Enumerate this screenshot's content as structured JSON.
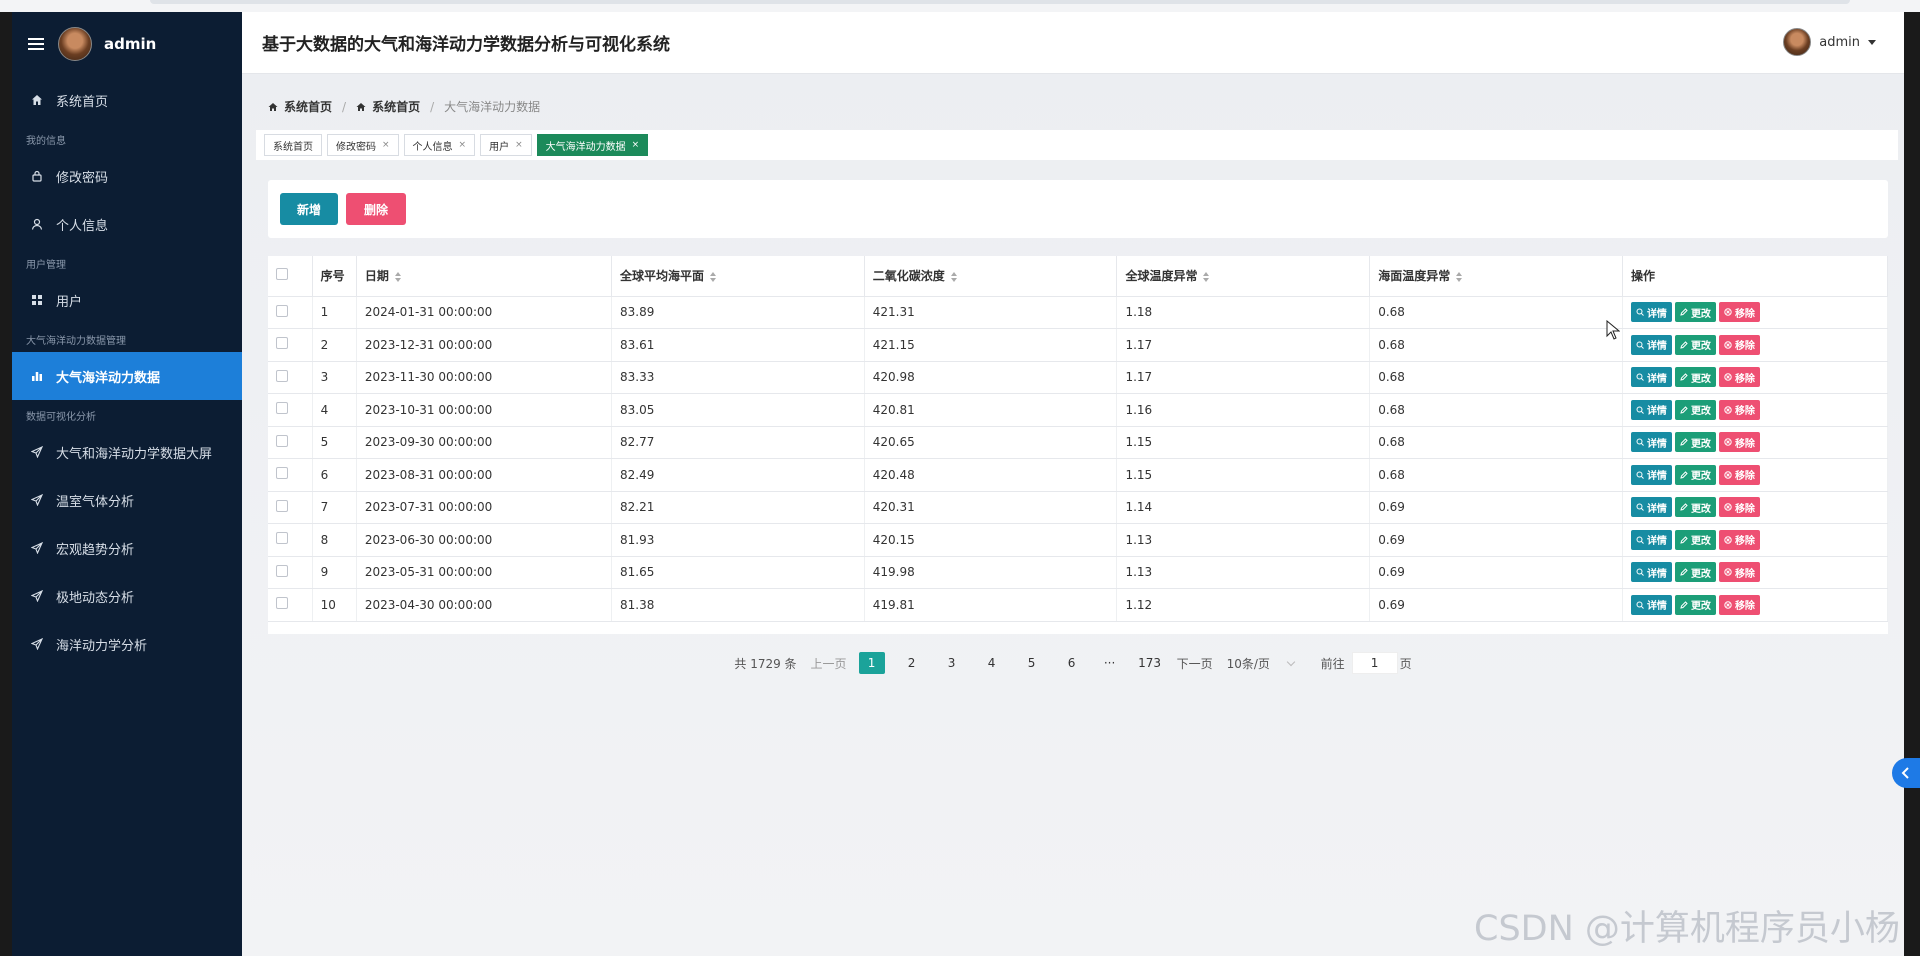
{
  "sidebar": {
    "username": "admin",
    "items": [
      {
        "type": "item",
        "label": "系统首页",
        "icon": "home-icon"
      },
      {
        "type": "group",
        "label": "我的信息"
      },
      {
        "type": "item",
        "label": "修改密码",
        "icon": "lock-icon"
      },
      {
        "type": "item",
        "label": "个人信息",
        "icon": "user-icon"
      },
      {
        "type": "group",
        "label": "用户管理"
      },
      {
        "type": "item",
        "label": "用户",
        "icon": "grid-icon"
      },
      {
        "type": "group",
        "label": "大气海洋动力数据管理"
      },
      {
        "type": "item",
        "label": "大气海洋动力数据",
        "icon": "bar-chart-icon",
        "active": true
      },
      {
        "type": "group",
        "label": "数据可视化分析"
      },
      {
        "type": "item",
        "label": "大气和海洋动力学数据大屏",
        "icon": "send-icon"
      },
      {
        "type": "item",
        "label": "温室气体分析",
        "icon": "send-icon"
      },
      {
        "type": "item",
        "label": "宏观趋势分析",
        "icon": "send-icon"
      },
      {
        "type": "item",
        "label": "极地动态分析",
        "icon": "send-icon"
      },
      {
        "type": "item",
        "label": "海洋动力学分析",
        "icon": "send-icon"
      }
    ]
  },
  "header": {
    "title": "基于大数据的大气和海洋动力学数据分析与可视化系统",
    "username": "admin"
  },
  "breadcrumb": [
    "系统首页",
    "系统首页",
    "大气海洋动力数据"
  ],
  "tags": [
    {
      "label": "系统首页",
      "closable": false
    },
    {
      "label": "修改密码",
      "closable": true
    },
    {
      "label": "个人信息",
      "closable": true
    },
    {
      "label": "用户",
      "closable": true
    },
    {
      "label": "大气海洋动力数据",
      "closable": true,
      "active": true
    }
  ],
  "tag_close": "×",
  "actions": {
    "add_label": "新增",
    "delete_label": "删除"
  },
  "table": {
    "columns": [
      "序号",
      "日期",
      "全球平均海平面",
      "二氧化碳浓度",
      "全球温度异常",
      "海面温度异常",
      "操作"
    ],
    "ops": {
      "view": "详情",
      "edit": "更改",
      "remove": "移除"
    },
    "rows": [
      [
        "1",
        "2024-01-31 00:00:00",
        "83.89",
        "421.31",
        "1.18",
        "0.68"
      ],
      [
        "2",
        "2023-12-31 00:00:00",
        "83.61",
        "421.15",
        "1.17",
        "0.68"
      ],
      [
        "3",
        "2023-11-30 00:00:00",
        "83.33",
        "420.98",
        "1.17",
        "0.68"
      ],
      [
        "4",
        "2023-10-31 00:00:00",
        "83.05",
        "420.81",
        "1.16",
        "0.68"
      ],
      [
        "5",
        "2023-09-30 00:00:00",
        "82.77",
        "420.65",
        "1.15",
        "0.68"
      ],
      [
        "6",
        "2023-08-31 00:00:00",
        "82.49",
        "420.48",
        "1.15",
        "0.68"
      ],
      [
        "7",
        "2023-07-31 00:00:00",
        "82.21",
        "420.31",
        "1.14",
        "0.69"
      ],
      [
        "8",
        "2023-06-30 00:00:00",
        "81.93",
        "420.15",
        "1.13",
        "0.69"
      ],
      [
        "9",
        "2023-05-31 00:00:00",
        "81.65",
        "419.98",
        "1.13",
        "0.69"
      ],
      [
        "10",
        "2023-04-30 00:00:00",
        "81.38",
        "419.81",
        "1.12",
        "0.69"
      ]
    ]
  },
  "pagination": {
    "total_text": "共 1729 条",
    "prev": "上一页",
    "pages": [
      "1",
      "2",
      "3",
      "4",
      "5",
      "6"
    ],
    "current": "1",
    "ellipsis": "···",
    "last_page": "173",
    "next": "下一页",
    "page_size": "10条/页",
    "goto_label": "前往",
    "goto_value": "1",
    "goto_suffix": "页"
  },
  "watermark": "CSDN @计算机程序员小杨",
  "colors": {
    "sidebar_bg": "#0c1d33",
    "active": "#1d7fd9",
    "teal": "#178ca3",
    "green": "#1c9e78",
    "pink": "#ee4f72"
  }
}
